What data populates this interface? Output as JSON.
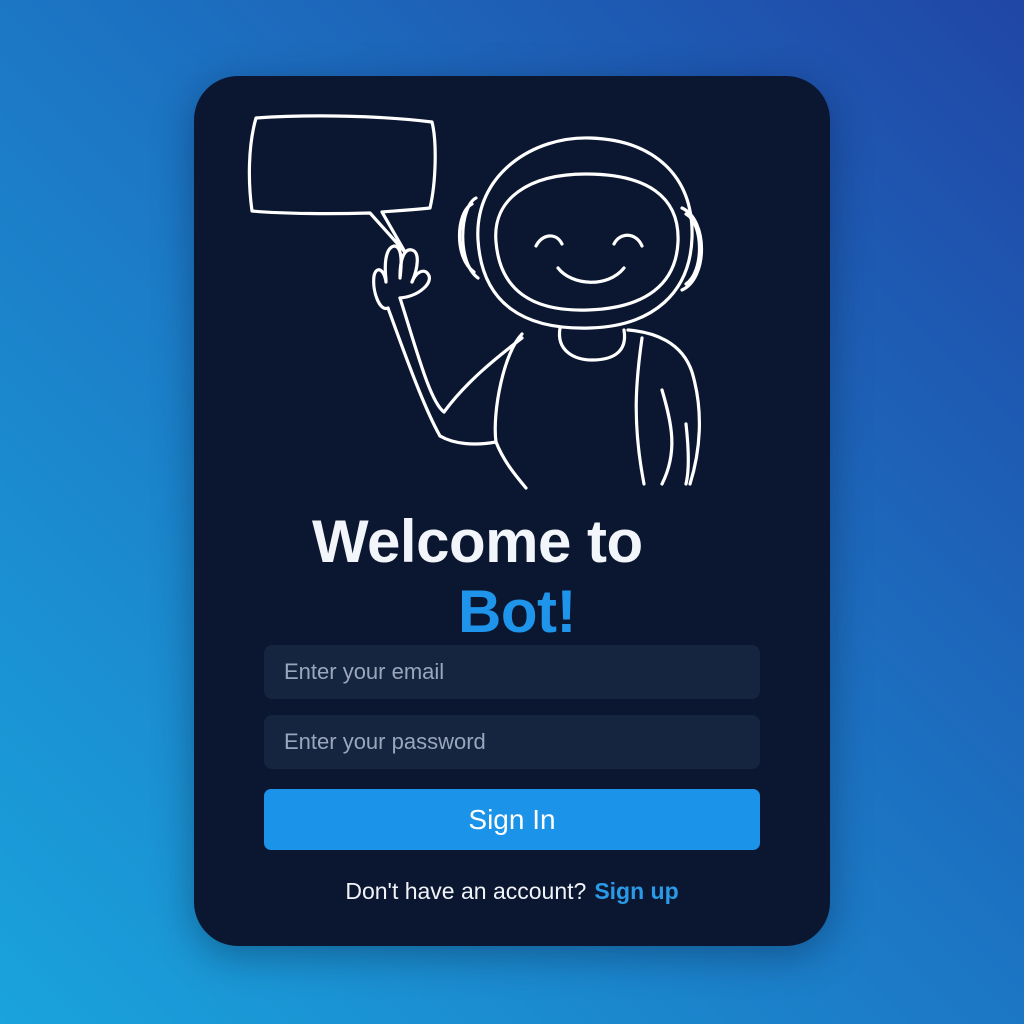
{
  "welcome": {
    "line1": "Welcome to",
    "line2": "Bot!"
  },
  "form": {
    "email_placeholder": "Enter your email",
    "password_placeholder": "Enter your password",
    "signin_label": "Sign In"
  },
  "footer": {
    "prompt": "Don't have an account?",
    "signup_label": "Sign up"
  },
  "colors": {
    "background_start": "#1aa3dc",
    "background_end": "#2046a6",
    "card": "#0b1730",
    "input": "#15243f",
    "accent": "#1b93e9",
    "text": "#f2f5fa"
  },
  "icons": [
    "robot-illustration",
    "speech-bubble-icon"
  ]
}
